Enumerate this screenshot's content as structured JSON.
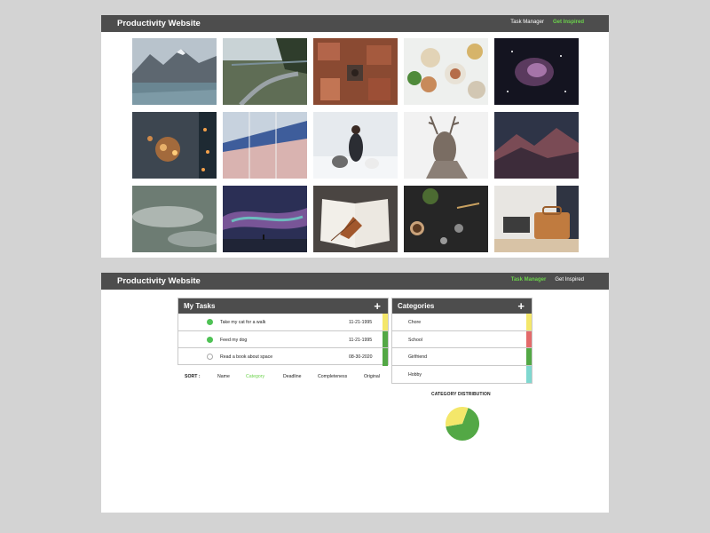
{
  "top_screen": {
    "navbar": {
      "brand": "Productivity Website",
      "links": [
        {
          "label": "Task Manager",
          "active": false
        },
        {
          "label": "Get Inspired",
          "active": true
        }
      ]
    },
    "photos": [
      "mountain-lake",
      "coastal-road",
      "aerial-rooftops",
      "breakfast-table",
      "orion-nebula",
      "city-lights-bokeh",
      "building-facade",
      "woman-with-huskies",
      "deer-portrait",
      "mountain-sunset",
      "foggy-forest",
      "aurora-night",
      "open-book-leaf",
      "coffee-flatlay",
      "laptop-leather-bag"
    ]
  },
  "bottom_screen": {
    "navbar": {
      "brand": "Productivity Website",
      "links": [
        {
          "label": "Task Manager",
          "active": true
        },
        {
          "label": "Get Inspired",
          "active": false
        }
      ]
    },
    "tasks": {
      "title": "My Tasks",
      "add_label": "+",
      "items": [
        {
          "name": "Take my cat for a walk",
          "date": "11-21-1995",
          "done": true,
          "category_color": "#f4e76a"
        },
        {
          "name": "Feed my dog",
          "date": "11-21-1995",
          "done": true,
          "category_color": "#53a845"
        },
        {
          "name": "Read a book about space",
          "date": "08-30-2020",
          "done": false,
          "category_color": "#53a845"
        }
      ]
    },
    "sort": {
      "label": "SORT :",
      "options": [
        {
          "label": "Name",
          "active": false
        },
        {
          "label": "Category",
          "active": true
        },
        {
          "label": "Deadline",
          "active": false
        },
        {
          "label": "Completeness",
          "active": false
        },
        {
          "label": "Original",
          "active": false
        }
      ]
    },
    "categories": {
      "title": "Categories",
      "add_label": "+",
      "items": [
        {
          "name": "Chore",
          "color": "#f4e76a"
        },
        {
          "name": "School",
          "color": "#e36a6a"
        },
        {
          "name": "Girlfriend",
          "color": "#53a845"
        },
        {
          "name": "Hobby",
          "color": "#7fd8d0"
        }
      ]
    },
    "distribution": {
      "title": "CATEGORY DISTRIBUTION",
      "slices": [
        {
          "category": "Girlfriend",
          "fraction": 0.667,
          "color": "#53a845"
        },
        {
          "category": "Chore",
          "fraction": 0.333,
          "color": "#f4e76a"
        }
      ]
    }
  },
  "colors": {
    "page_bg": "#d3d3d3",
    "navbar_bg": "#4d4d4d",
    "accent_green": "#6bd24b"
  }
}
